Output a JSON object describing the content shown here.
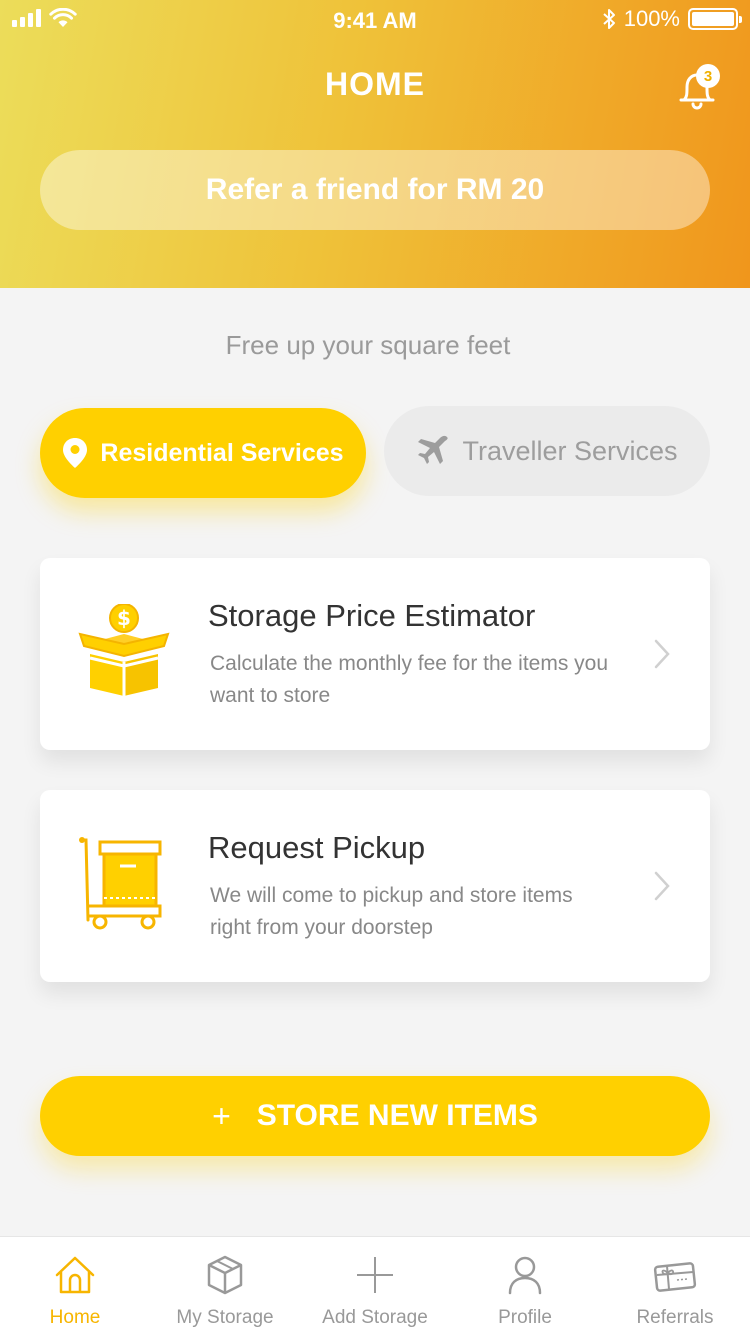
{
  "status_bar": {
    "time": "9:41 AM",
    "battery_text": "100%",
    "icons": [
      "signal-icon",
      "wifi-icon",
      "bluetooth-icon",
      "battery-icon"
    ]
  },
  "header": {
    "title": "HOME",
    "notification_count": "3",
    "refer_banner": "Refer a friend for RM 20"
  },
  "tagline": "Free up your square feet",
  "service_tabs": [
    {
      "label": "Residential Services",
      "icon": "location-pin-icon",
      "selected": true
    },
    {
      "label": "Traveller Services",
      "icon": "airplane-icon",
      "selected": false
    }
  ],
  "cards": [
    {
      "title": "Storage Price Estimator",
      "description": "Calculate the monthly fee for the items you want to store",
      "icon": "dollar-box-icon"
    },
    {
      "title": "Request Pickup",
      "description": "We will come to pickup and store items right from your doorstep",
      "icon": "trolley-box-icon"
    }
  ],
  "store_button": {
    "plus": "+",
    "label": "STORE NEW ITEMS"
  },
  "tabbar": [
    {
      "label": "Home",
      "icon": "home-icon",
      "active": true
    },
    {
      "label": "My Storage",
      "icon": "box-icon",
      "active": false
    },
    {
      "label": "Add Storage",
      "icon": "plus-icon",
      "active": false
    },
    {
      "label": "Profile",
      "icon": "person-icon",
      "active": false
    },
    {
      "label": "Referrals",
      "icon": "gift-card-icon",
      "active": false
    }
  ],
  "colors": {
    "accent": "#ffd000",
    "header_gradient_start": "#ecdd5a",
    "header_gradient_end": "#f0961c",
    "tab_active": "#f7b500"
  }
}
